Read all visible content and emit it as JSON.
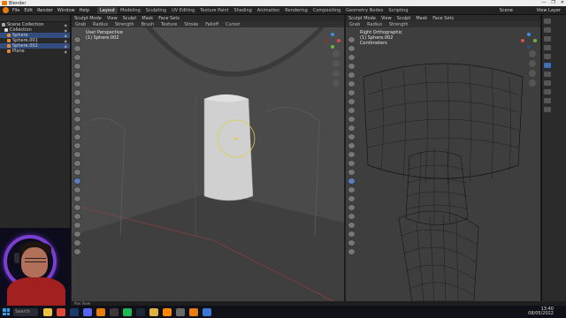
{
  "window": {
    "title": "Blender",
    "controls": [
      "—",
      "❐",
      "✕"
    ]
  },
  "menubar": {
    "menus": [
      "File",
      "Edit",
      "Render",
      "Window",
      "Help"
    ],
    "workspaces": [
      "Layout",
      "Modeling",
      "Sculpting",
      "UV Editing",
      "Texture Paint",
      "Shading",
      "Animation",
      "Rendering",
      "Compositing",
      "Geometry Nodes",
      "Scripting"
    ],
    "active_workspace": "Layout",
    "scene": "Scene",
    "view_layer": "View Layer"
  },
  "outliner": {
    "items": [
      {
        "label": "Scene Collection",
        "color": "#aaaaaa",
        "selected": false
      },
      {
        "label": "Collection",
        "color": "#dddddd",
        "selected": false
      },
      {
        "label": "Sphere",
        "color": "#e08a3c",
        "selected": true
      },
      {
        "label": "Sphere.001",
        "color": "#e08a3c",
        "selected": false
      },
      {
        "label": "Sphere.002",
        "color": "#e08a3c",
        "selected": true
      },
      {
        "label": "Plane",
        "color": "#e08a3c",
        "selected": false
      }
    ]
  },
  "viewport_left": {
    "header": [
      "Sculpt Mode",
      "View",
      "Sculpt",
      "Mask",
      "Face Sets"
    ],
    "tool_header": [
      "Grab",
      "Radius",
      "Strength",
      "Brush",
      "Texture",
      "Stroke",
      "Falloff",
      "Cursor"
    ],
    "info_line1": "User Perspective",
    "info_line2": "(1) Sphere.002"
  },
  "viewport_right": {
    "header": [
      "Sculpt Mode",
      "View",
      "Sculpt",
      "Mask",
      "Face Sets"
    ],
    "tool_header": [
      "Grab",
      "Radius",
      "Strength"
    ],
    "info_line1": "Right Orthographic",
    "info_line2": "(1) Sphere.002",
    "info_line3": "Centimeters"
  },
  "statusbar": {
    "left": "Pan View"
  },
  "taskbar": {
    "search": "Search",
    "time": "13:40",
    "date": "08/05/2022",
    "apps": [
      {
        "name": "file-explorer",
        "color": "#f0c040"
      },
      {
        "name": "chrome",
        "color": "#e04a3a"
      },
      {
        "name": "photoshop",
        "color": "#1b3a6b"
      },
      {
        "name": "discord",
        "color": "#5865f2"
      },
      {
        "name": "blender",
        "color": "#e87d0d"
      },
      {
        "name": "obs",
        "color": "#3a3a3a"
      },
      {
        "name": "spotify",
        "color": "#1db954"
      },
      {
        "name": "steam",
        "color": "#1b2838"
      },
      {
        "name": "folder",
        "color": "#e0b040"
      },
      {
        "name": "vlc",
        "color": "#ff8800"
      },
      {
        "name": "notes",
        "color": "#6a6a6a"
      },
      {
        "name": "blender-2",
        "color": "#e87d0d"
      },
      {
        "name": "photos",
        "color": "#3b78d8"
      }
    ]
  },
  "colors": {
    "accent": "#5680c2",
    "brush_circle": "#e0d040",
    "selection": "#334d80"
  }
}
